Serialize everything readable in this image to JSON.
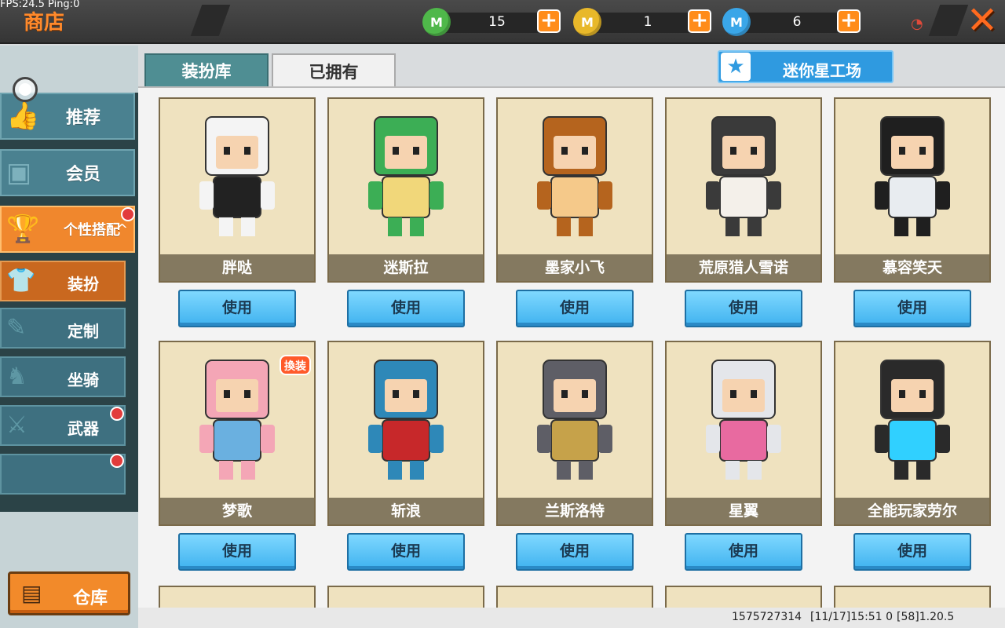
{
  "debug": {
    "fps_text": "FPS:24.5  Ping:0"
  },
  "header": {
    "title": "商店",
    "currencies": [
      {
        "icon": "green-gem-icon",
        "color": "#4fb84a",
        "value": "15"
      },
      {
        "icon": "gold-coin-icon",
        "color": "#e8b82a",
        "value": "1"
      },
      {
        "icon": "mini-coin-icon",
        "color": "#3aa6e8",
        "value": "6"
      }
    ],
    "plus_label": "+",
    "close_label": "✕"
  },
  "sidebar": {
    "items": [
      {
        "label": "推荐",
        "icon": "thumbs-up-icon"
      },
      {
        "label": "会员",
        "icon": "vip-icon"
      },
      {
        "label": "个性搭配",
        "icon": "trophy-icon"
      }
    ],
    "sub_items": [
      {
        "label": "装扮",
        "icon": "shirt-icon",
        "active": true
      },
      {
        "label": "定制",
        "icon": "brush-icon",
        "active": false
      },
      {
        "label": "坐骑",
        "icon": "mount-icon",
        "active": false
      },
      {
        "label": "武器",
        "icon": "gun-icon",
        "active": false
      }
    ],
    "warehouse_label": "仓库"
  },
  "tabs": [
    {
      "label": "装扮库",
      "active": true
    },
    {
      "label": "已拥有",
      "active": false
    }
  ],
  "workshop_label": "迷你星工场",
  "skins": [
    {
      "name": "胖哒",
      "color": "#f4f4f4",
      "accent": "#222222"
    },
    {
      "name": "迷斯拉",
      "color": "#3cae55",
      "accent": "#f1d77a"
    },
    {
      "name": "墨家小飞",
      "color": "#b5641e",
      "accent": "#f5c98a"
    },
    {
      "name": "荒原猎人雪诺",
      "color": "#3a3a3a",
      "accent": "#f4f0ea"
    },
    {
      "name": "慕容笑天",
      "color": "#1f1f1f",
      "accent": "#e8ecf0"
    },
    {
      "name": "梦歌",
      "color": "#f4a6b6",
      "accent": "#6ab0e0"
    },
    {
      "name": "斩浪",
      "color": "#2e88b8",
      "accent": "#c7282a"
    },
    {
      "name": "兰斯洛特",
      "color": "#5e5e66",
      "accent": "#c6a24a"
    },
    {
      "name": "星翼",
      "color": "#e4e6ea",
      "accent": "#e86aa0"
    },
    {
      "name": "全能玩家劳尔",
      "color": "#2a2a2a",
      "accent": "#30d0ff"
    }
  ],
  "use_label": "使用",
  "badge_label": "換装",
  "footer": {
    "id": "1575727314",
    "time": "[11/17]15:51 0",
    "version": "[58]1.20.5"
  }
}
